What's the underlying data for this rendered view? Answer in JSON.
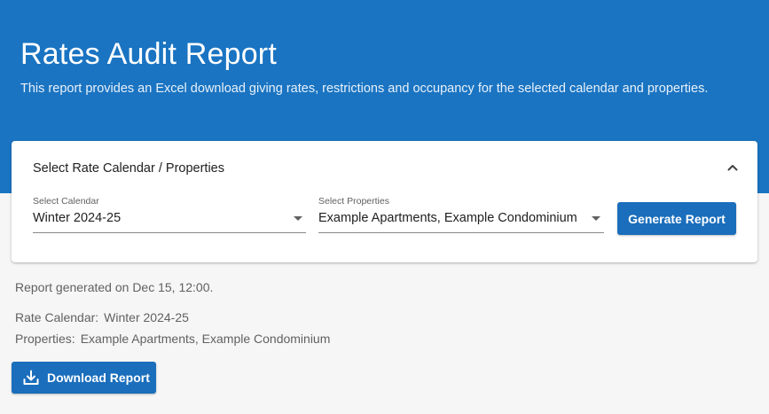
{
  "header": {
    "title": "Rates Audit Report",
    "description": "This report provides an Excel download giving rates, restrictions and occupancy for the selected calendar and properties."
  },
  "selection_card": {
    "title": "Select Rate Calendar / Properties",
    "collapse_icon": "chevron-up-icon",
    "calendar": {
      "label": "Select Calendar",
      "value": "Winter 2024-25"
    },
    "properties": {
      "label": "Select Properties",
      "value": "Example Apartments, Example Condominium"
    },
    "generate_label": "Generate Report"
  },
  "report": {
    "generated_text": "Report generated on Dec 15, 12:00.",
    "rate_calendar_label": "Rate Calendar:",
    "rate_calendar_value": "Winter 2024-25",
    "properties_label": "Properties:",
    "properties_value": "Example Apartments, Example Condominium",
    "download_label": "Download Report",
    "download_icon": "download-icon"
  },
  "colors": {
    "header_bg": "#1a74c2",
    "primary_button": "#1a6ebc",
    "page_bg": "#f6f6f6"
  }
}
